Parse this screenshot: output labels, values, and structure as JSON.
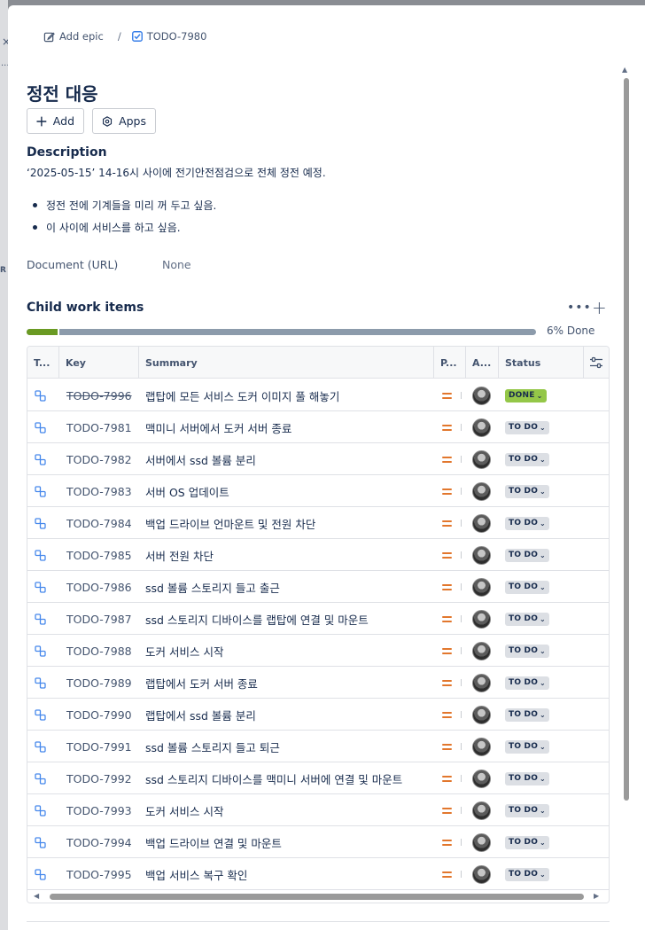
{
  "background": {
    "close_glyph": "×",
    "dots": "...",
    "side_letters": "R"
  },
  "breadcrumb": {
    "epic_label": "Add epic",
    "separator": "/",
    "issue_key": "TODO-7980"
  },
  "issue": {
    "title": "정전 대응"
  },
  "actions": {
    "add_label": "Add",
    "apps_label": "Apps"
  },
  "description": {
    "heading": "Description",
    "line": "‘2025-05-15’ 14-16시 사이에 전기안전점검으로 전체 정전 예정.",
    "bullets": [
      "정전 전에 기계들을 미리 꺼 두고 싶음.",
      "이 사이에 서비스를 하고 싶음."
    ]
  },
  "fields": {
    "document_label": "Document (URL)",
    "document_value": "None"
  },
  "child_items": {
    "heading": "Child work items",
    "more_icon": "more-icon",
    "progress_fraction": 0.06,
    "progress_label": "6% Done",
    "columns": {
      "type": "T...",
      "key": "Key",
      "summary": "Summary",
      "priority": "P...",
      "assignee": "A...",
      "status": "Status"
    },
    "rows": [
      {
        "key": "TODO-7996",
        "summary": "랩탑에 모든 서비스 도커 이미지 풀 해놓기",
        "status": "DONE",
        "done": true
      },
      {
        "key": "TODO-7981",
        "summary": "맥미니 서버에서 도커 서버 종료",
        "status": "TO DO",
        "done": false
      },
      {
        "key": "TODO-7982",
        "summary": "서버에서 ssd 볼륨 분리",
        "status": "TO DO",
        "done": false
      },
      {
        "key": "TODO-7983",
        "summary": "서버 OS 업데이트",
        "status": "TO DO",
        "done": false
      },
      {
        "key": "TODO-7984",
        "summary": "백업 드라이브 언마운트 및 전원 차단",
        "status": "TO DO",
        "done": false
      },
      {
        "key": "TODO-7985",
        "summary": "서버 전원 차단",
        "status": "TO DO",
        "done": false
      },
      {
        "key": "TODO-7986",
        "summary": "ssd 볼륨 스토리지 들고 출근",
        "status": "TO DO",
        "done": false
      },
      {
        "key": "TODO-7987",
        "summary": "ssd 스토리지 디바이스를 랩탑에 연결 및 마운트",
        "status": "TO DO",
        "done": false
      },
      {
        "key": "TODO-7988",
        "summary": "도커 서비스 시작",
        "status": "TO DO",
        "done": false
      },
      {
        "key": "TODO-7989",
        "summary": "랩탑에서 도커 서버 종료",
        "status": "TO DO",
        "done": false
      },
      {
        "key": "TODO-7990",
        "summary": "랩탑에서 ssd 볼륨 분리",
        "status": "TO DO",
        "done": false
      },
      {
        "key": "TODO-7991",
        "summary": "ssd 볼륨 스토리지 들고 퇴근",
        "status": "TO DO",
        "done": false
      },
      {
        "key": "TODO-7992",
        "summary": "ssd 스토리지 디바이스를 맥미니 서버에 연결 및 마운트",
        "status": "TO DO",
        "done": false
      },
      {
        "key": "TODO-7993",
        "summary": "도커 서비스 시작",
        "status": "TO DO",
        "done": false
      },
      {
        "key": "TODO-7994",
        "summary": "백업 드라이브 연결 및 마운트",
        "status": "TO DO",
        "done": false
      },
      {
        "key": "TODO-7995",
        "summary": "백업 서비스 복구 확인",
        "status": "TO DO",
        "done": false
      }
    ]
  },
  "colors": {
    "progress_done": "#6a9a23",
    "progress_rest": "#8c9bab",
    "status_done": "#94c748",
    "status_todo": "#dcdfe4",
    "priority_medium": "#e2772d",
    "subtask_icon": "#4688ec"
  }
}
